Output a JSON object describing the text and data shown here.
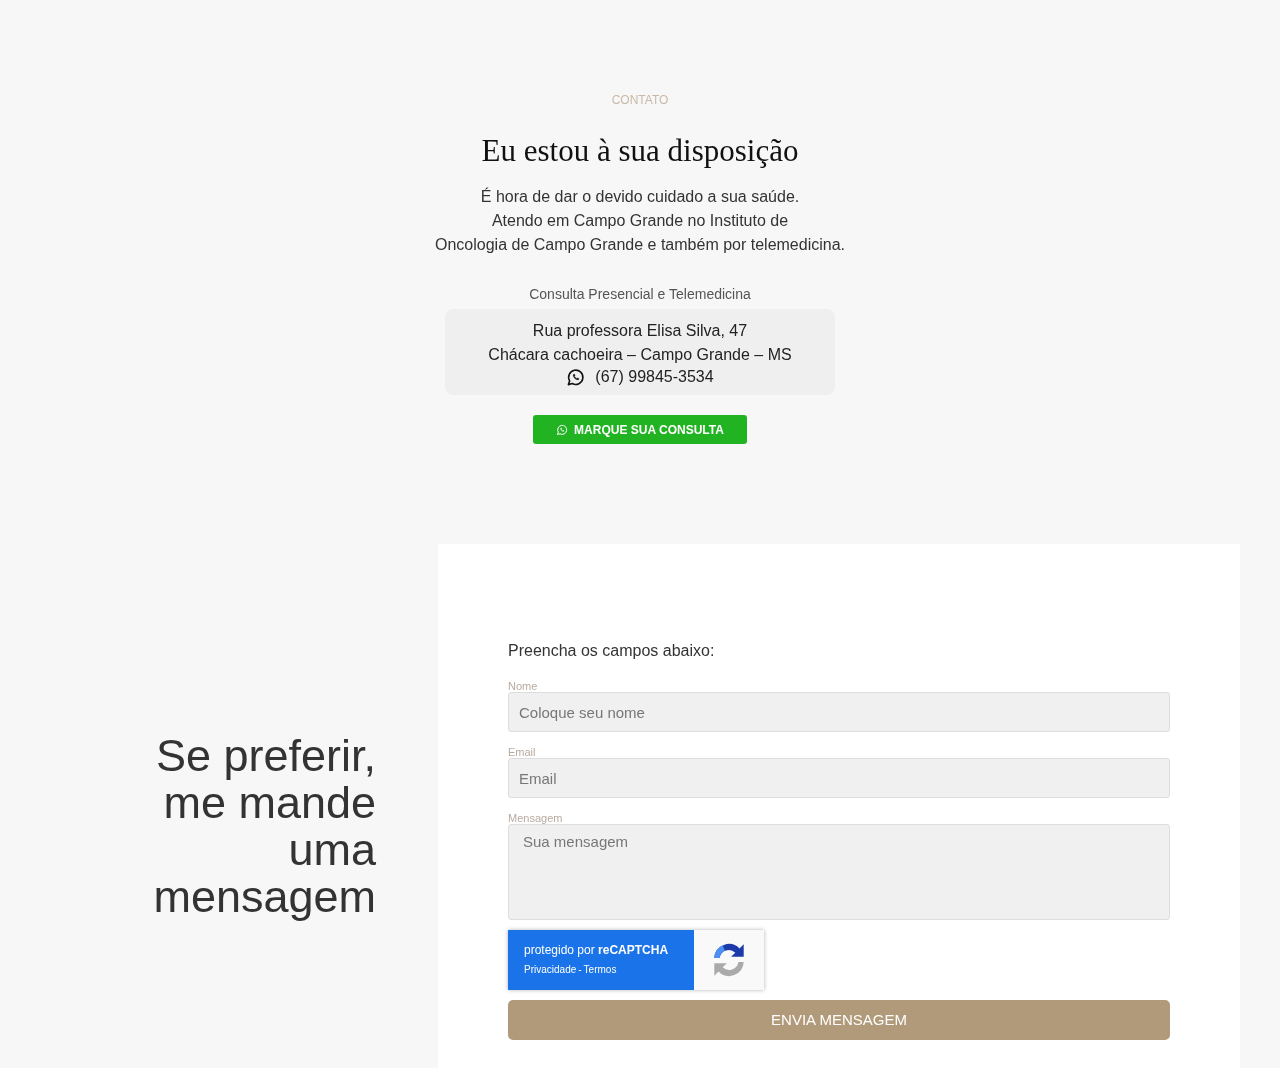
{
  "contact": {
    "eyebrow": "CONTATO",
    "title": "Eu estou à sua disposição",
    "intro": [
      "É hora de dar o devido cuidado a sua saúde.",
      "Atendo em Campo Grande no Instituto de",
      "Oncologia de Campo Grande e também por telemedicina."
    ],
    "subtitle": "Consulta Presencial e Telemedicina",
    "address": [
      "Rua professora Elisa Silva, 47",
      "Chácara cachoeira – Campo Grande – MS"
    ],
    "phone": "(67) 99845-3534",
    "cta": "MARQUE SUA CONSULTA"
  },
  "message": {
    "heading": "Se preferir, me mande uma mensagem"
  },
  "form": {
    "intro": "Preencha os campos abaixo:",
    "fields": [
      {
        "kind": "input",
        "label": "Nome",
        "placeholder": "Coloque seu nome"
      },
      {
        "kind": "input",
        "label": "Email",
        "placeholder": "Email"
      },
      {
        "kind": "textarea",
        "label": "Mensagem",
        "placeholder": "Sua mensagem"
      }
    ],
    "captcha": {
      "text": "protegido por **reCAPTCHA**",
      "links": [
        "Privacidade",
        "Termos"
      ],
      "separator": "-"
    },
    "submit": "ENVIA MENSAGEM"
  }
}
